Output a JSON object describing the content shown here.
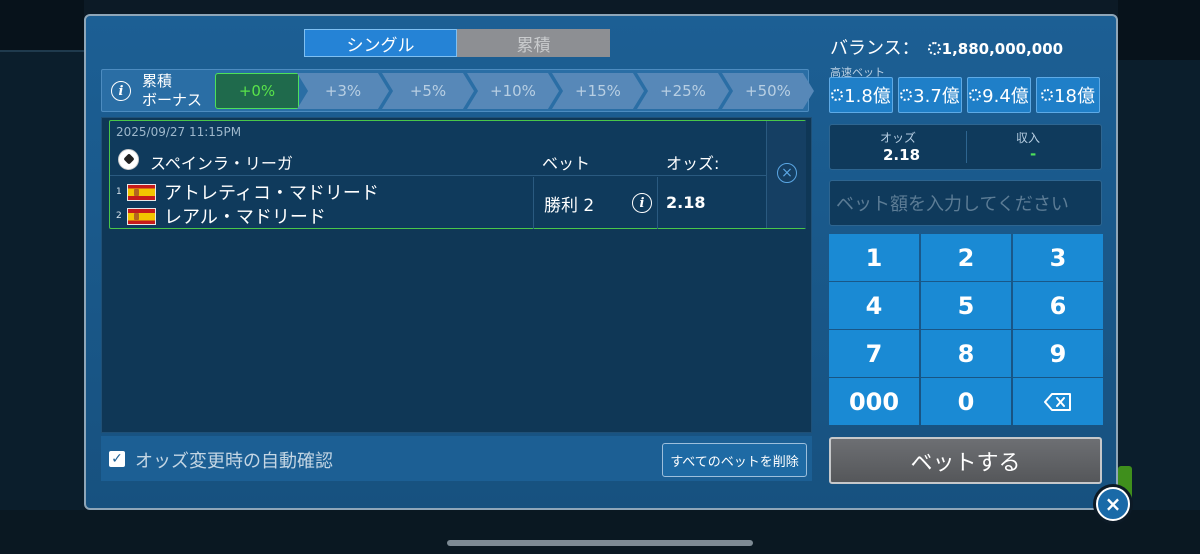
{
  "tabs": {
    "single": "シングル",
    "accumulator": "累積"
  },
  "bonus": {
    "label_line1": "累積",
    "label_line2": "ボーナス",
    "steps": [
      "+0%",
      "+3%",
      "+5%",
      "+10%",
      "+15%",
      "+25%",
      "+50%"
    ],
    "active_index": 0
  },
  "bet": {
    "datetime": "2025/09/27 11:15PM",
    "league": "スペインラ・リーガ",
    "col_bet": "ベット",
    "col_odds": "オッズ:",
    "team1_num": "1",
    "team1": "アトレティコ・マドリード",
    "team2_num": "2",
    "team2": "レアル・マドリード",
    "pick": "勝利 2",
    "odds": "2.18"
  },
  "footer": {
    "auto_confirm": "オッズ変更時の自動確認",
    "auto_confirm_checked": true,
    "delete_all": "すべてのベットを削除"
  },
  "balance": {
    "label": "バランス：",
    "amount": "1,880,000,000"
  },
  "quick": {
    "label": "高速ベット",
    "amounts": [
      "1.8億",
      "3.7億",
      "9.4億",
      "18億"
    ]
  },
  "odds_box": {
    "odds_label": "オッズ",
    "odds_value": "2.18",
    "income_label": "収入",
    "income_value": "-"
  },
  "amount_input": {
    "placeholder": "ベット額を入力してください"
  },
  "keypad": {
    "keys": [
      "1",
      "2",
      "3",
      "4",
      "5",
      "6",
      "7",
      "8",
      "9",
      "000",
      "0"
    ]
  },
  "bet_button": "ベットする",
  "colors": {
    "accent": "#2583d6",
    "key": "#1a8ad4",
    "success": "#49c64a",
    "panel": "#1c5f94"
  }
}
